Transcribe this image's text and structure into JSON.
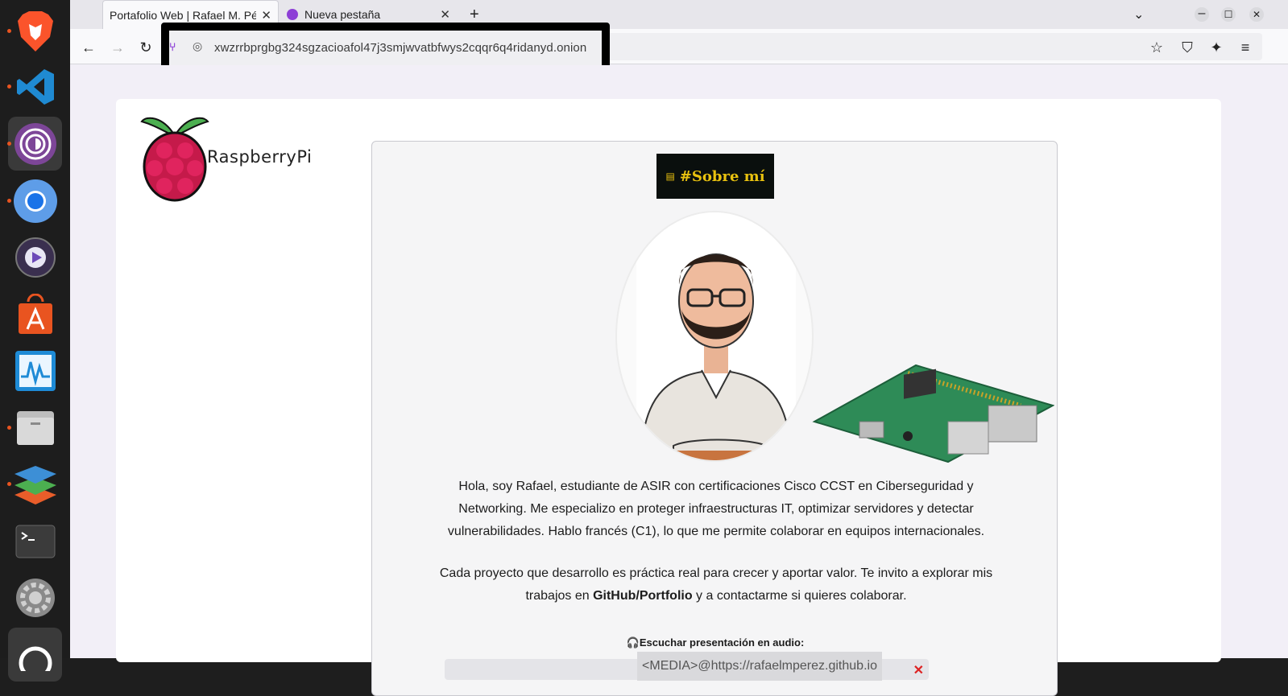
{
  "dock": {
    "items": [
      "brave-browser",
      "vscode",
      "tor-browser",
      "chromium",
      "media-player",
      "app-center",
      "system-monitor",
      "files",
      "layers-app",
      "terminal",
      "settings",
      "ubuntu"
    ]
  },
  "browser": {
    "tabs": [
      {
        "label": "Portafolio Web | Rafael M. Pé",
        "active": true
      },
      {
        "label": "Nueva pestaña",
        "active": false
      }
    ],
    "url": "xwzrrbprgbg324sgzacioafol47j3smjwvatbfwys2cqqr6q4ridanyd.onion"
  },
  "page": {
    "logo_text": "RaspberryPi",
    "badge": "#Sobre mí",
    "intro": "Hola, soy Rafael, estudiante de ASIR con certificaciones Cisco CCST en Ciberseguridad y Networking. Me especializo en proteger infraestructuras IT, optimizar servidores y detectar vulnerabilidades. Hablo francés (C1), lo que me permite colaborar en equipos internacionales.",
    "cta_before": "Cada proyecto que desarrollo es práctica real para crecer y aportar valor. Te invito a explorar mis trabajos en ",
    "cta_link": "GitHub/Portfolio",
    "cta_after": " y a contactarme si quieres colaborar.",
    "audio_label": "Escuchar presentación en audio:",
    "media_text": "<MEDIA>@https://rafaelmperez.github.io"
  }
}
